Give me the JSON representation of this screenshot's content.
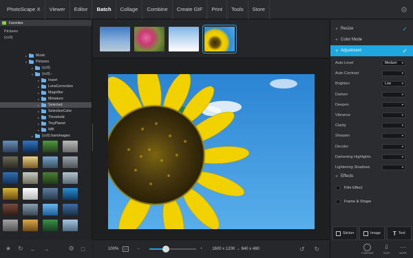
{
  "menu": {
    "items": [
      "PhotoScape X",
      "Viewer",
      "Editor",
      "Batch",
      "Collage",
      "Combine",
      "Create GIF",
      "Print",
      "Tools",
      "Store"
    ],
    "active_index": 3
  },
  "left": {
    "favorites_label": "Favorites",
    "places": [
      "Pictures",
      "(cc0)"
    ],
    "tree": [
      {
        "label": "Music",
        "depth": 1,
        "expanded": false
      },
      {
        "label": "Pictures",
        "depth": 1,
        "expanded": true
      },
      {
        "label": "(cc0)",
        "depth": 2,
        "expanded": false
      },
      {
        "label": "(cc0) -",
        "depth": 2,
        "expanded": true
      },
      {
        "label": "Insert",
        "depth": 3,
        "expanded": false
      },
      {
        "label": "LensCorrection",
        "depth": 3,
        "expanded": false
      },
      {
        "label": "Magnifier",
        "depth": 3,
        "expanded": false
      },
      {
        "label": "Miniature",
        "depth": 3,
        "expanded": false
      },
      {
        "label": "Selected",
        "depth": 3,
        "expanded": false,
        "selected": true
      },
      {
        "label": "SelectiveColor",
        "depth": 3,
        "expanded": false
      },
      {
        "label": "Threshold",
        "depth": 3,
        "expanded": false
      },
      {
        "label": "TinyPlanet",
        "depth": 3,
        "expanded": false
      },
      {
        "label": "WB",
        "depth": 3,
        "expanded": false
      },
      {
        "label": "(cc0) bamimages",
        "depth": 2,
        "expanded": false
      }
    ]
  },
  "center": {
    "zoom": "100%",
    "fit_label": "1:1",
    "zoom_level": 0.35,
    "dimensions": "1600 x 1200 → 640 x 480"
  },
  "right": {
    "sections": [
      {
        "label": "Resize",
        "checked": true
      },
      {
        "label": "Color Mode",
        "checked": false
      },
      {
        "label": "Adjustment",
        "checked": true,
        "active": true
      }
    ],
    "adjustments": [
      {
        "label": "Auto Level",
        "value": "Medium"
      },
      {
        "label": "Auto Contrast",
        "value": ""
      },
      {
        "label": "Brighten",
        "value": "Low"
      },
      {
        "label": "Darken",
        "value": ""
      },
      {
        "label": "Deepen",
        "value": ""
      },
      {
        "label": "Vibrance",
        "value": ""
      },
      {
        "label": "Clarity",
        "value": ""
      },
      {
        "label": "Sharpen",
        "value": ""
      },
      {
        "label": "Decolor",
        "value": ""
      },
      {
        "label": "Darkening Highlights",
        "value": ""
      },
      {
        "label": "Lightening Shadows",
        "value": ""
      }
    ],
    "effects_label": "Effects",
    "checkboxes": [
      "Film Effect",
      "Frame & Shape"
    ],
    "tools": [
      "Sticker",
      "Image",
      "Text"
    ],
    "bottom_buttons": [
      "COMPARE",
      "SAVE",
      "MORE"
    ]
  },
  "colors": {
    "accent": "#1ea7e1",
    "sky": "#2f8fd8",
    "petal": "#f2d100",
    "seed": "#4b3a10"
  }
}
